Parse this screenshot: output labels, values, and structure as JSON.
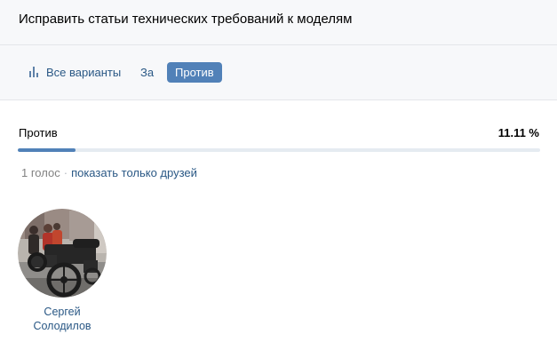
{
  "header": {
    "title": "Исправить статьи технических требований к моделям"
  },
  "tabs": [
    {
      "label": "Все варианты",
      "icon": "bar-chart-icon",
      "active": false
    },
    {
      "label": "За",
      "active": false
    },
    {
      "label": "Против",
      "active": true
    }
  ],
  "option": {
    "label": "Против",
    "percent_text": "11.11 %",
    "percent": 11.11
  },
  "votes": {
    "count_text": "1 голос",
    "separator": "·",
    "friends_link": "показать только друзей"
  },
  "voters": [
    {
      "name_line1": "Сергей",
      "name_line2": "Солодилов",
      "avatar": "photo-avatar"
    }
  ],
  "colors": {
    "accent": "#5181b8",
    "link": "#2a5885",
    "header_bg": "#f7f8fa",
    "track": "#e5ebf1",
    "muted": "#828282"
  }
}
